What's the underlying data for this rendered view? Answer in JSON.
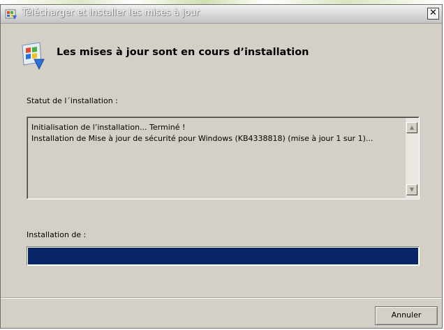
{
  "window": {
    "title": "Télécharger et installer les mises à jour",
    "close_glyph": "✕"
  },
  "header": {
    "heading": "Les mises à jour sont en cours d’installation",
    "icon": "windows-update-icon"
  },
  "status": {
    "label": "Statut de l´installation :",
    "log_lines": [
      "Initialisation de l’installation... Terminé !",
      "Installation de Mise à jour de sécurité pour Windows (KB4338818) (mise à jour 1 sur 1)..."
    ]
  },
  "install": {
    "label": "Installation de  :",
    "progress_fraction": 1.0
  },
  "footer": {
    "cancel_label": "Annuler"
  },
  "colors": {
    "dialog_bg": "#d4d0c8",
    "progress_fill": "#0a246a"
  }
}
